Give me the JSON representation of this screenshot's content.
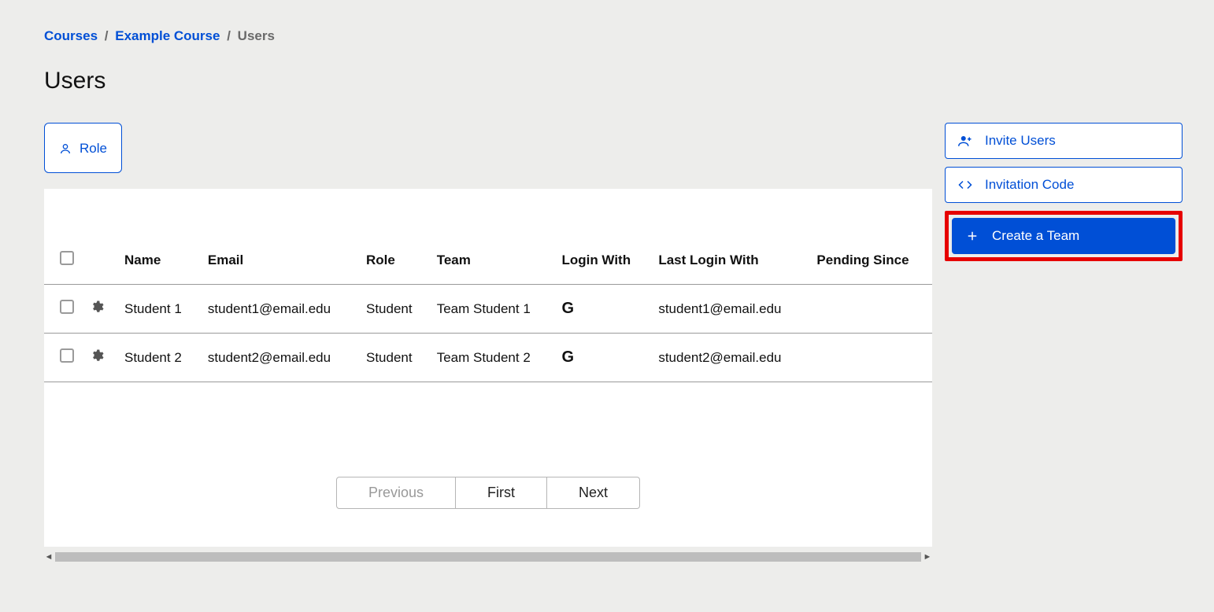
{
  "breadcrumb": {
    "courses": "Courses",
    "course": "Example Course",
    "current": "Users"
  },
  "page_title": "Users",
  "role_filter_label": "Role",
  "actions": {
    "invite": "Invite Users",
    "invitation_code": "Invitation Code",
    "create_team": "Create a Team"
  },
  "table": {
    "headers": {
      "name": "Name",
      "email": "Email",
      "role": "Role",
      "team": "Team",
      "login_with": "Login With",
      "last_login_with": "Last Login With",
      "pending_since": "Pending Since"
    },
    "rows": [
      {
        "name": "Student 1",
        "email": "student1@email.edu",
        "role": "Student",
        "team": "Team Student 1",
        "login_with": "G",
        "last_login_with": "student1@email.edu",
        "pending_since": ""
      },
      {
        "name": "Student 2",
        "email": "student2@email.edu",
        "role": "Student",
        "team": "Team Student 2",
        "login_with": "G",
        "last_login_with": "student2@email.edu",
        "pending_since": ""
      }
    ]
  },
  "pagination": {
    "previous": "Previous",
    "first": "First",
    "next": "Next"
  }
}
